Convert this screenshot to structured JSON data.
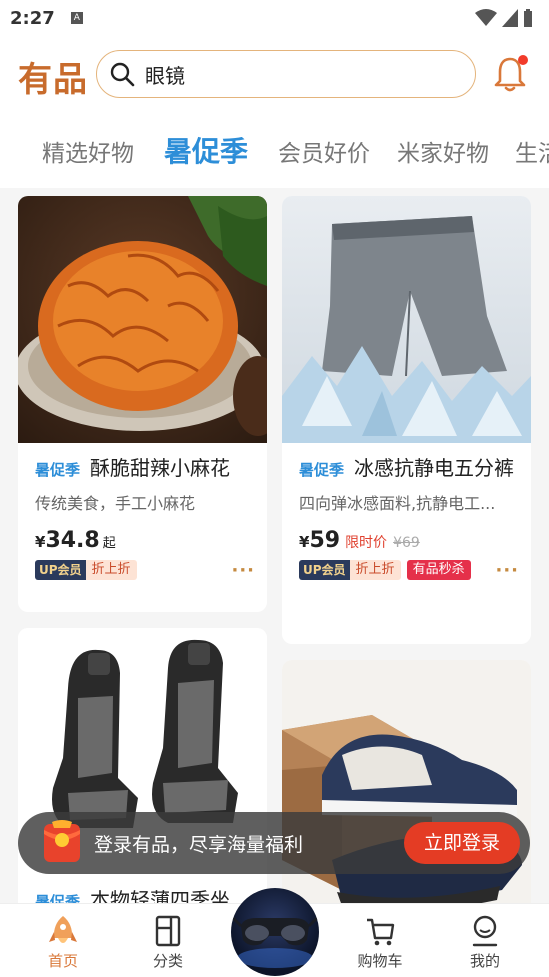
{
  "status": {
    "time": "2:27",
    "a_icon": "A"
  },
  "header": {
    "logo": "有品",
    "search_value": "眼镜"
  },
  "tabs": [
    "精选好物",
    "暑促季",
    "会员好价",
    "米家好物",
    "生活"
  ],
  "active_tab": 1,
  "products": [
    {
      "promo": "暑促季",
      "title": "酥脆甜辣小麻花",
      "desc": "传统美食，手工小麻花",
      "currency": "¥",
      "price": "34.8",
      "suffix": "起",
      "vip_tag": "UP会员",
      "off_tag": "折上折",
      "more": "···"
    },
    {
      "promo": "暑促季",
      "title": "冰感抗静电五分裤",
      "desc": "四向弹冰感面料,抗静电工...",
      "currency": "¥",
      "price": "59",
      "limit": "限时价",
      "orig": "¥69",
      "vip_tag": "UP会员",
      "off_tag": "折上折",
      "flash_tag": "有品秒杀",
      "more": "···"
    },
    {
      "promo": "暑促季",
      "title": "本物轻薄四季坐"
    }
  ],
  "login_banner": {
    "text": "登录有品，尽享海量福利",
    "button": "立即登录"
  },
  "nav": {
    "home": "首页",
    "category": "分类",
    "cart": "购物车",
    "mine": "我的"
  }
}
